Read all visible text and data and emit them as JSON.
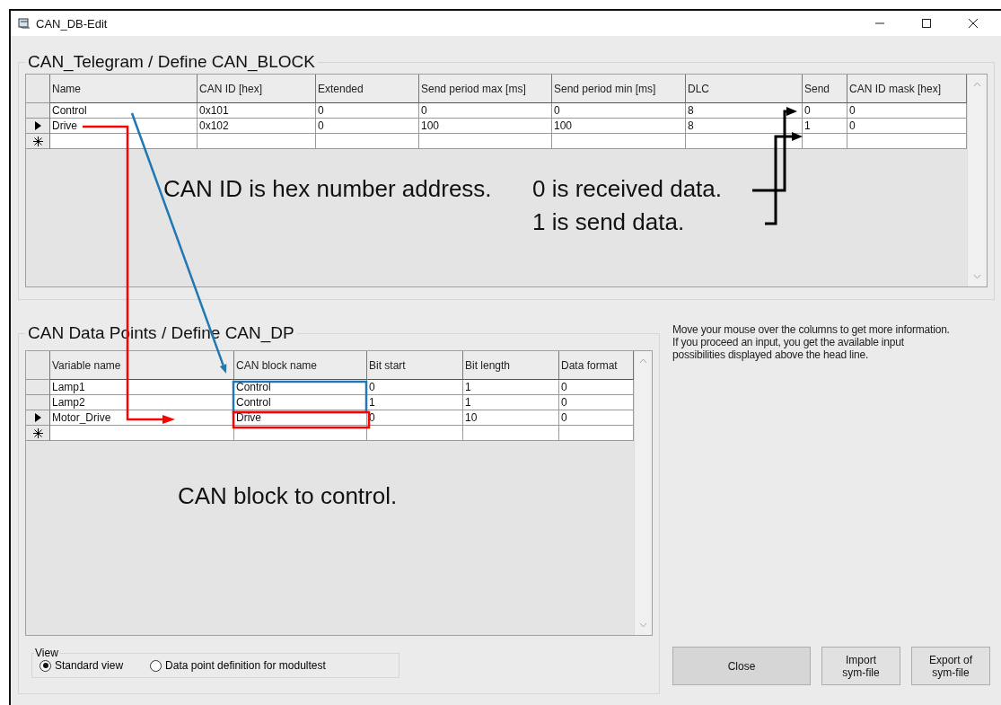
{
  "window": {
    "title": "CAN_DB-Edit"
  },
  "telegram": {
    "title": "CAN_Telegram / Define CAN_BLOCK",
    "columns": [
      "Name",
      "CAN ID [hex]",
      "Extended",
      "Send period max [ms]",
      "Send period min [ms]",
      "DLC",
      "Send",
      "CAN ID mask [hex]"
    ],
    "rows": [
      {
        "current": false,
        "cells": [
          "Control",
          "0x101",
          "0",
          "0",
          "0",
          "8",
          "0",
          "0"
        ]
      },
      {
        "current": true,
        "cells": [
          "Drive",
          "0x102",
          "0",
          "100",
          "100",
          "8",
          "1",
          "0"
        ]
      }
    ]
  },
  "data_points": {
    "title": "CAN Data Points / Define CAN_DP",
    "columns": [
      "Variable name",
      "CAN block name",
      "Bit start",
      "Bit length",
      "Data format"
    ],
    "rows": [
      {
        "current": false,
        "cells": [
          "Lamp1",
          "Control",
          "0",
          "1",
          "0"
        ]
      },
      {
        "current": false,
        "cells": [
          "Lamp2",
          "Control",
          "1",
          "1",
          "0"
        ]
      },
      {
        "current": true,
        "cells": [
          "Motor_Drive",
          "Drive",
          "0",
          "10",
          "0"
        ]
      }
    ]
  },
  "view": {
    "title": "View",
    "options": [
      {
        "label": "Standard view",
        "selected": true
      },
      {
        "label": "Data point definition for modultest",
        "selected": false
      }
    ]
  },
  "help_lines": [
    "Move your mouse over the columns to get more information.",
    "If you proceed an input, you get the available input",
    "possibilities displayed above the head line."
  ],
  "buttons": [
    {
      "label": "Close",
      "kind": "wide"
    },
    {
      "label": "Import sym-file",
      "kind": "small"
    },
    {
      "label": "Export of sym-file",
      "kind": "small"
    }
  ],
  "annotations": [
    "CAN ID is hex number address.",
    "0 is received data.",
    "1 is send data.",
    "CAN block to control."
  ]
}
